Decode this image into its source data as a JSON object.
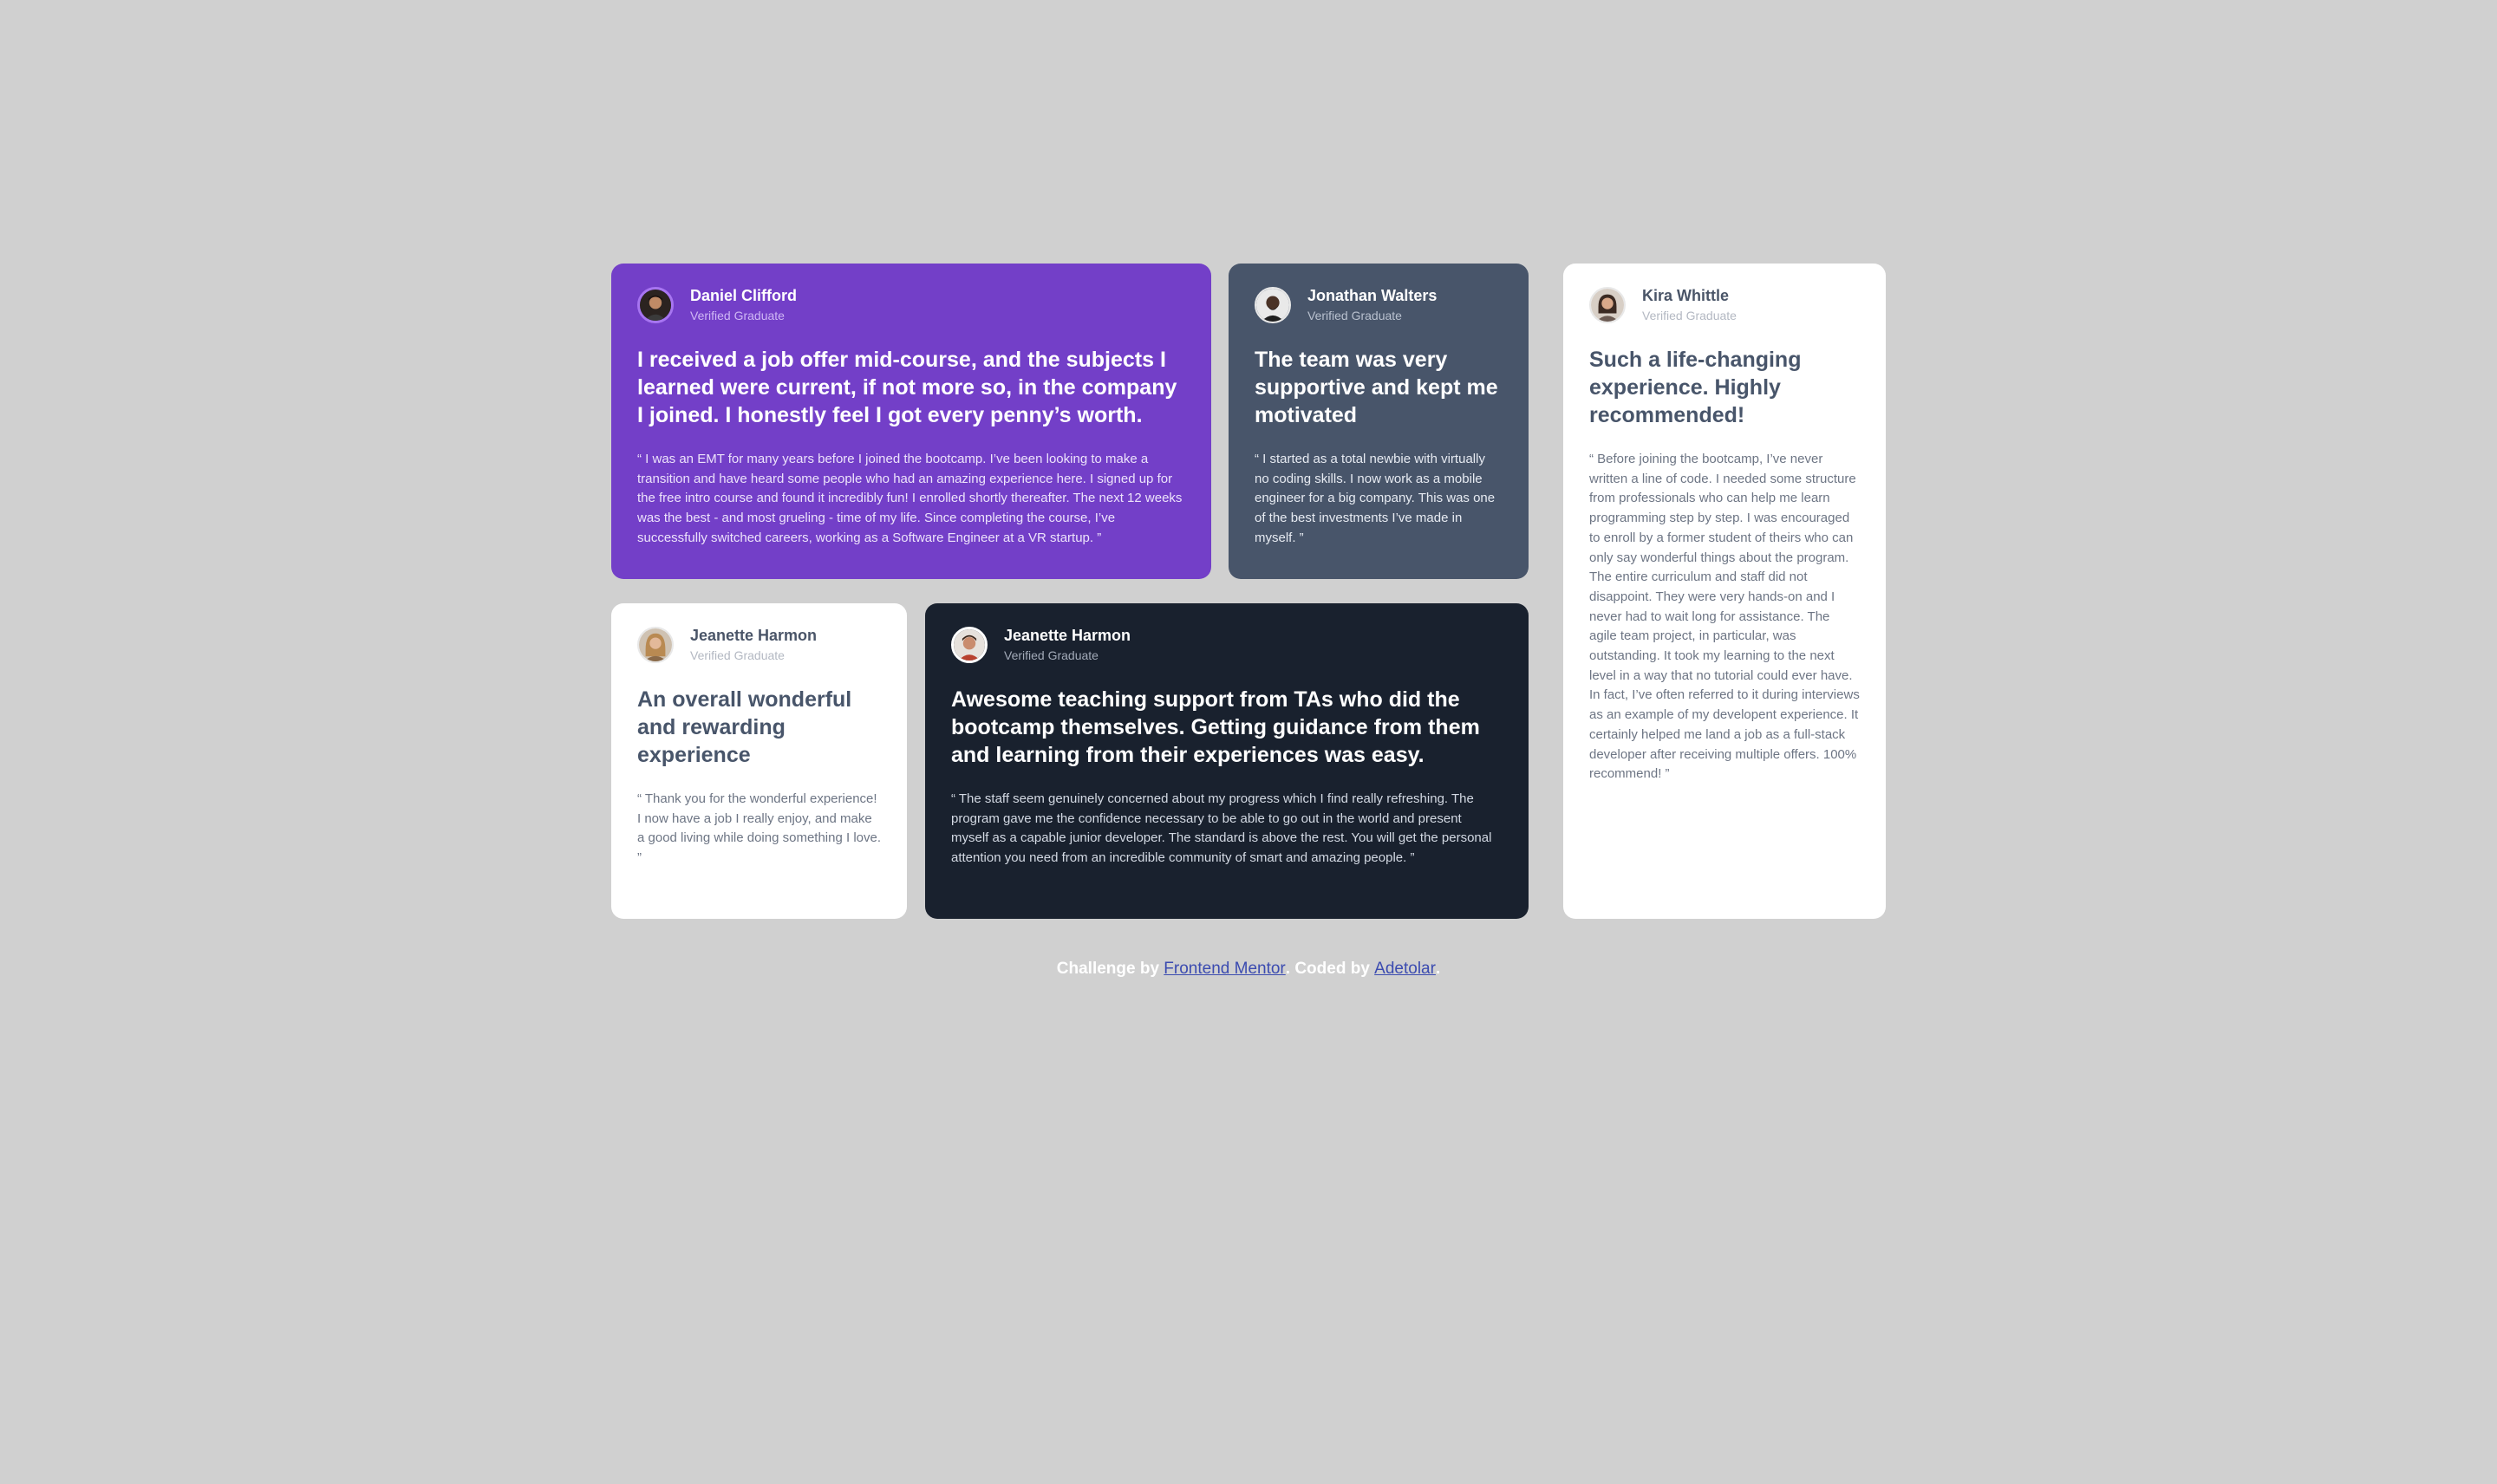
{
  "colors": {
    "page_background": "#d0d0d0",
    "purple_card": "#733fc8",
    "slate_card": "#48556a",
    "white_card": "#ffffff",
    "dark_card": "#19212e",
    "link": "#3b4bb0"
  },
  "testimonials": [
    {
      "name": "Daniel Clifford",
      "status": "Verified Graduate",
      "headline": "I received a job offer mid-course, and the subjects I learned were current, if not more so, in the company I joined. I honestly feel I got every penny’s worth.",
      "quote": "“ I was an EMT for many years before I joined the bootcamp. I’ve been looking to make a transition and have heard some people who had an amazing experience here. I signed up for the free intro course and found it incredibly fun! I enrolled shortly thereafter. The next 12 weeks was the best - and most grueling - time of my life. Since completing the course, I’ve successfully switched careers, working as a Software Engineer at a VR startup. ”"
    },
    {
      "name": "Jonathan Walters",
      "status": "Verified Graduate",
      "headline": "The team was very supportive and kept me motivated",
      "quote": "“ I started as a total newbie with virtually no coding skills. I now work as a mobile engineer for a big company. This was one of the best investments I’ve made in myself. ”"
    },
    {
      "name": "Kira Whittle",
      "status": "Verified Graduate",
      "headline": "Such a life-changing experience. Highly recommended!",
      "quote": "“ Before joining the bootcamp, I’ve never written a line of code. I needed some structure from professionals who can help me learn programming step by step. I was encouraged to enroll by a former student of theirs who can only say wonderful things about the program. The entire curriculum and staff did not disappoint. They were very hands-on and I never had to wait long for assistance. The agile team project, in particular, was outstanding. It took my learning to the next level in a way that no tutorial could ever have. In fact, I’ve often referred to it during interviews as an example of my developent experience. It certainly helped me land a job as a full-stack developer after receiving multiple offers. 100% recommend! ”"
    },
    {
      "name": "Jeanette Harmon",
      "status": "Verified Graduate",
      "headline": "An overall wonderful and rewarding experience",
      "quote": "“ Thank you for the wonderful experience! I now have a job I really enjoy, and make a good living while doing something I love. ”"
    },
    {
      "name": "Jeanette Harmon",
      "status": "Verified Graduate",
      "headline": "Awesome teaching support from TAs who did the bootcamp themselves. Getting guidance from them and learning from their experiences was easy.",
      "quote": "“ The staff seem genuinely concerned about my progress which I find really refreshing. The program gave me the confidence necessary to be able to go out in the world and present myself as a capable junior developer. The standard is above the rest. You will get the personal attention you need from an incredible community of smart and amazing people. ”"
    }
  ],
  "footer": {
    "prefix": "Challenge by",
    "link1": "Frontend Mentor",
    "middle": ". Coded by",
    "link2": "Adetolar",
    "suffix": "."
  }
}
